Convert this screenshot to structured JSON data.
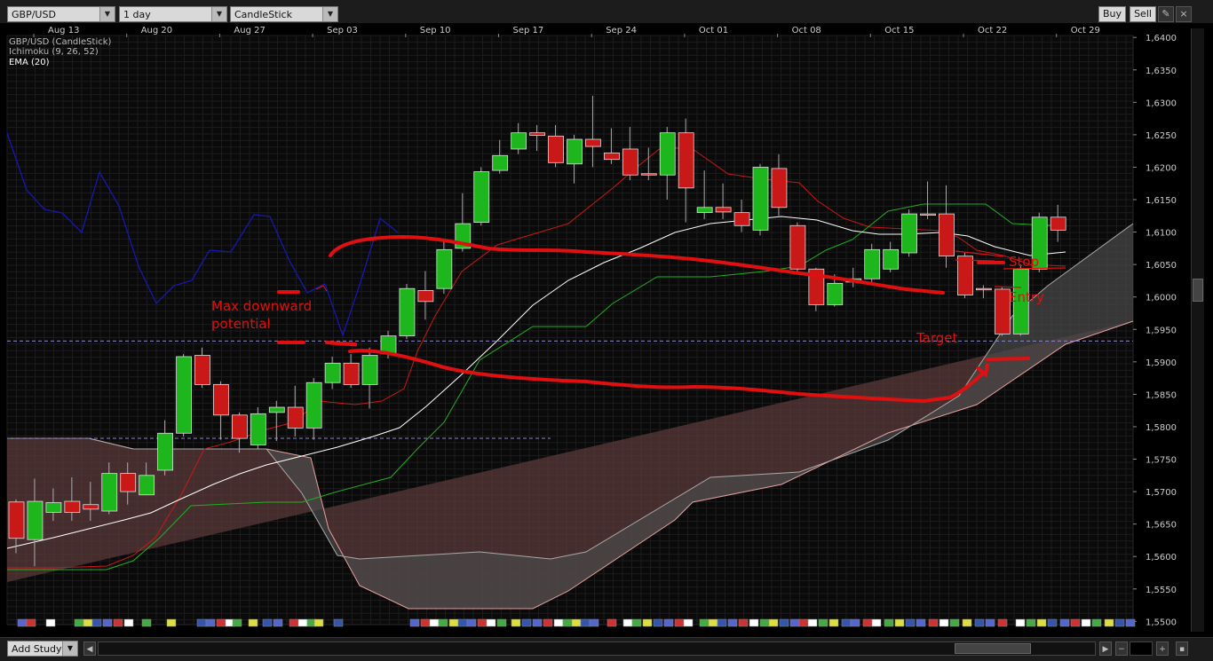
{
  "toolbar": {
    "symbol": "GBP/USD",
    "interval": "1 day",
    "chart_type": "CandleStick",
    "buy_label": "Buy",
    "sell_label": "Sell",
    "draw_icon": "pencil-icon",
    "close_icon": "close-icon"
  },
  "legend": {
    "line1": "GBP/USD (CandleStick)",
    "line2": "Ichimoku (9, 26, 52)",
    "line3": "EMA (20)"
  },
  "annotations": {
    "max_downward": "Max downward",
    "potential": "potential",
    "stop": "Stop",
    "entry": "Entry",
    "target": "Target"
  },
  "bottombar": {
    "add_study": "Add Study",
    "zoom_out": "−",
    "zoom_in": "+"
  },
  "colors": {
    "up": "#1db71d",
    "down": "#c81818",
    "annotation": "#e01010",
    "tenkan": "#c81818",
    "kijun": "#20b020",
    "chikou": "#1818b0",
    "ema": "#ffffff"
  },
  "chart_data": {
    "type": "candlestick",
    "x_labels": [
      "Aug 13",
      "Aug 20",
      "Aug 27",
      "Sep 03",
      "Sep 10",
      "Sep 17",
      "Sep 24",
      "Oct 01",
      "Oct 08",
      "Oct 15",
      "Oct 22",
      "Oct 29"
    ],
    "y_ticks": [
      "1,6400",
      "1,6350",
      "1,6300",
      "1,6250",
      "1,6200",
      "1,6150",
      "1,6100",
      "1,6050",
      "1,6000",
      "1,5950",
      "1,5900",
      "1,5850",
      "1,5800",
      "1,5750",
      "1,5700",
      "1,5650",
      "1,5600",
      "1,5550",
      "1,5500"
    ],
    "ylim": [
      1.5495,
      1.6403
    ],
    "grid": true,
    "candles": [
      {
        "x": 0,
        "o": 1.5684,
        "c": 1.5628,
        "h": 1.5688,
        "l": 1.5605
      },
      {
        "x": 1,
        "o": 1.5626,
        "c": 1.5685,
        "h": 1.572,
        "l": 1.5585
      },
      {
        "x": 2,
        "o": 1.5668,
        "c": 1.5683,
        "h": 1.5705,
        "l": 1.5655
      },
      {
        "x": 3,
        "o": 1.5685,
        "c": 1.5668,
        "h": 1.5722,
        "l": 1.5655
      },
      {
        "x": 4,
        "o": 1.568,
        "c": 1.5673,
        "h": 1.5715,
        "l": 1.5655
      },
      {
        "x": 5,
        "o": 1.567,
        "c": 1.5728,
        "h": 1.5745,
        "l": 1.5665
      },
      {
        "x": 6,
        "o": 1.5728,
        "c": 1.57,
        "h": 1.5745,
        "l": 1.568
      },
      {
        "x": 7,
        "o": 1.5695,
        "c": 1.5725,
        "h": 1.5745,
        "l": 1.5695
      },
      {
        "x": 8,
        "o": 1.5733,
        "c": 1.579,
        "h": 1.581,
        "l": 1.5725
      },
      {
        "x": 9,
        "o": 1.579,
        "c": 1.5908,
        "h": 1.5912,
        "l": 1.5785
      },
      {
        "x": 10,
        "o": 1.591,
        "c": 1.5865,
        "h": 1.5922,
        "l": 1.586
      },
      {
        "x": 11,
        "o": 1.5865,
        "c": 1.5818,
        "h": 1.587,
        "l": 1.578
      },
      {
        "x": 12,
        "o": 1.5818,
        "c": 1.5782,
        "h": 1.5822,
        "l": 1.576
      },
      {
        "x": 13,
        "o": 1.5772,
        "c": 1.582,
        "h": 1.583,
        "l": 1.5765
      },
      {
        "x": 14,
        "o": 1.5822,
        "c": 1.583,
        "h": 1.584,
        "l": 1.5778
      },
      {
        "x": 15,
        "o": 1.583,
        "c": 1.5798,
        "h": 1.5863,
        "l": 1.5785
      },
      {
        "x": 16,
        "o": 1.5798,
        "c": 1.5868,
        "h": 1.5875,
        "l": 1.578
      },
      {
        "x": 17,
        "o": 1.5868,
        "c": 1.5898,
        "h": 1.5908,
        "l": 1.5858
      },
      {
        "x": 18,
        "o": 1.5898,
        "c": 1.5865,
        "h": 1.5912,
        "l": 1.586
      },
      {
        "x": 19,
        "o": 1.5865,
        "c": 1.591,
        "h": 1.5922,
        "l": 1.5828
      },
      {
        "x": 20,
        "o": 1.5913,
        "c": 1.594,
        "h": 1.5948,
        "l": 1.5905
      },
      {
        "x": 21,
        "o": 1.594,
        "c": 1.6013,
        "h": 1.602,
        "l": 1.5935
      },
      {
        "x": 22,
        "o": 1.601,
        "c": 1.5993,
        "h": 1.604,
        "l": 1.5965
      },
      {
        "x": 23,
        "o": 1.6013,
        "c": 1.6073,
        "h": 1.609,
        "l": 1.6005
      },
      {
        "x": 24,
        "o": 1.6075,
        "c": 1.6113,
        "h": 1.616,
        "l": 1.607
      },
      {
        "x": 25,
        "o": 1.6115,
        "c": 1.6193,
        "h": 1.62,
        "l": 1.611
      },
      {
        "x": 26,
        "o": 1.6195,
        "c": 1.6218,
        "h": 1.6242,
        "l": 1.619
      },
      {
        "x": 27,
        "o": 1.6228,
        "c": 1.6253,
        "h": 1.6268,
        "l": 1.622
      },
      {
        "x": 28,
        "o": 1.6253,
        "c": 1.6249,
        "h": 1.6265,
        "l": 1.6225
      },
      {
        "x": 29,
        "o": 1.6248,
        "c": 1.6207,
        "h": 1.6265,
        "l": 1.62
      },
      {
        "x": 30,
        "o": 1.6205,
        "c": 1.6243,
        "h": 1.625,
        "l": 1.6175
      },
      {
        "x": 31,
        "o": 1.6243,
        "c": 1.6232,
        "h": 1.631,
        "l": 1.62
      },
      {
        "x": 32,
        "o": 1.6222,
        "c": 1.6212,
        "h": 1.626,
        "l": 1.6205
      },
      {
        "x": 33,
        "o": 1.6228,
        "c": 1.6188,
        "h": 1.6262,
        "l": 1.618
      },
      {
        "x": 34,
        "o": 1.619,
        "c": 1.6188,
        "h": 1.623,
        "l": 1.618
      },
      {
        "x": 35,
        "o": 1.6188,
        "c": 1.6253,
        "h": 1.6262,
        "l": 1.615
      },
      {
        "x": 36,
        "o": 1.6253,
        "c": 1.6168,
        "h": 1.6275,
        "l": 1.6115
      },
      {
        "x": 37,
        "o": 1.613,
        "c": 1.6138,
        "h": 1.6195,
        "l": 1.612
      },
      {
        "x": 38,
        "o": 1.6138,
        "c": 1.6131,
        "h": 1.6175,
        "l": 1.612
      },
      {
        "x": 39,
        "o": 1.613,
        "c": 1.611,
        "h": 1.615,
        "l": 1.61
      },
      {
        "x": 40,
        "o": 1.6103,
        "c": 1.62,
        "h": 1.6205,
        "l": 1.6095
      },
      {
        "x": 41,
        "o": 1.6198,
        "c": 1.6138,
        "h": 1.622,
        "l": 1.6125
      },
      {
        "x": 42,
        "o": 1.611,
        "c": 1.6043,
        "h": 1.6115,
        "l": 1.6035
      },
      {
        "x": 43,
        "o": 1.6043,
        "c": 1.5988,
        "h": 1.6045,
        "l": 1.5978
      },
      {
        "x": 44,
        "o": 1.5988,
        "c": 1.6021,
        "h": 1.6035,
        "l": 1.5985
      },
      {
        "x": 45,
        "o": 1.6023,
        "c": 1.6028,
        "h": 1.6045,
        "l": 1.6015
      },
      {
        "x": 46,
        "o": 1.6028,
        "c": 1.6073,
        "h": 1.6082,
        "l": 1.602
      },
      {
        "x": 47,
        "o": 1.6043,
        "c": 1.6073,
        "h": 1.6085,
        "l": 1.6038
      },
      {
        "x": 48,
        "o": 1.6068,
        "c": 1.6128,
        "h": 1.6135,
        "l": 1.6062
      },
      {
        "x": 49,
        "o": 1.6128,
        "c": 1.6126,
        "h": 1.6178,
        "l": 1.612
      },
      {
        "x": 50,
        "o": 1.6128,
        "c": 1.6063,
        "h": 1.6172,
        "l": 1.6045
      },
      {
        "x": 51,
        "o": 1.6063,
        "c": 1.6003,
        "h": 1.6068,
        "l": 1.5998
      },
      {
        "x": 52,
        "o": 1.6013,
        "c": 1.6012,
        "h": 1.6018,
        "l": 1.5998
      },
      {
        "x": 53,
        "o": 1.6012,
        "c": 1.5943,
        "h": 1.6015,
        "l": 1.594
      },
      {
        "x": 54,
        "o": 1.5943,
        "c": 1.6043,
        "h": 1.605,
        "l": 1.594
      },
      {
        "x": 55,
        "o": 1.6043,
        "c": 1.6123,
        "h": 1.613,
        "l": 1.6038
      },
      {
        "x": 56,
        "o": 1.6123,
        "c": 1.6103,
        "h": 1.6142,
        "l": 1.6085
      }
    ]
  }
}
